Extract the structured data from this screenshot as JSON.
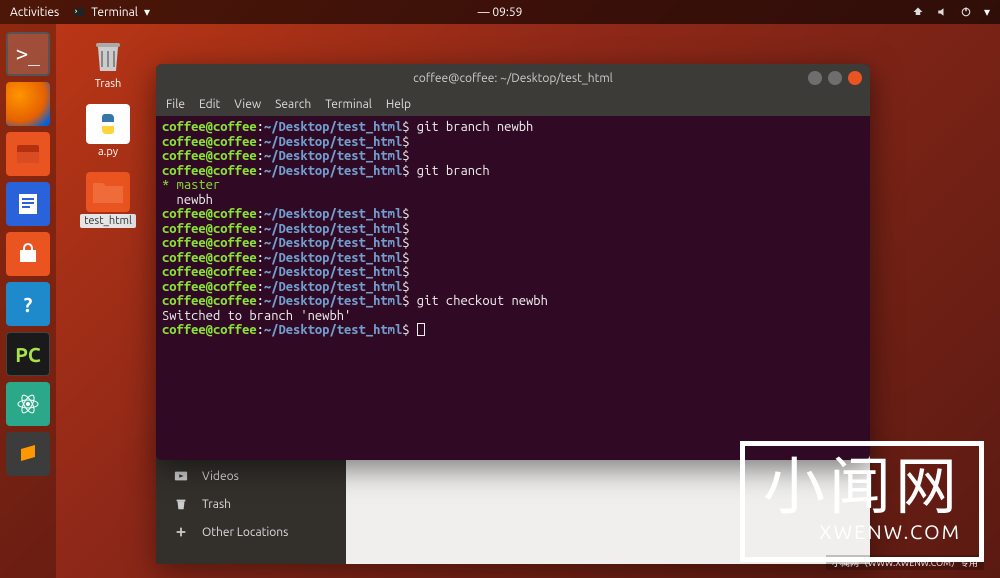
{
  "topbar": {
    "activities": "Activities",
    "app_name": "Terminal",
    "clock": "09:59"
  },
  "desktop": {
    "trash": "Trash",
    "apy": "a.py",
    "folder": "test_html"
  },
  "terminal": {
    "title": "coffee@coffee: ~/Desktop/test_html",
    "menus": [
      "File",
      "Edit",
      "View",
      "Search",
      "Terminal",
      "Help"
    ],
    "user": "coffee@coffee",
    "colon": ":",
    "path": "~/Desktop/test_html",
    "dollar": "$",
    "cmds": {
      "c1": " git branch newbh",
      "c2": " git branch",
      "c3": " git checkout newbh"
    },
    "branch_out": {
      "l1": "* master",
      "l2": "  newbh"
    },
    "switched": "Switched to branch 'newbh'"
  },
  "files": {
    "videos": "Videos",
    "trash": "Trash",
    "other": "Other Locations"
  },
  "watermark": {
    "big": "小闻网",
    "sub": "XWENW.COM",
    "bar": "小闻网（WWW.XWENW.COM）专用"
  }
}
